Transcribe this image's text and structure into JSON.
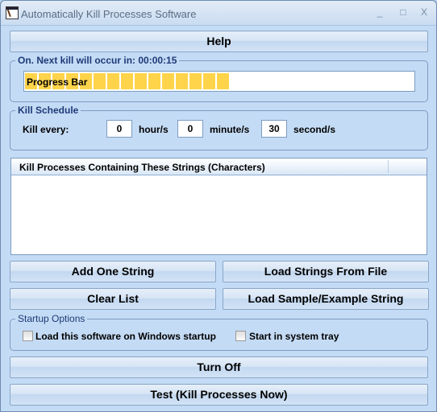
{
  "window": {
    "title": "Automatically Kill Processes Software",
    "controls": {
      "minimize": "_",
      "maximize": "□",
      "close": "X"
    }
  },
  "buttons": {
    "help": "Help",
    "add_one_string": "Add One String",
    "load_strings_from_file": "Load Strings From File",
    "clear_list": "Clear List",
    "load_sample": "Load Sample/Example String",
    "turn_off": "Turn Off",
    "test": "Test (Kill Processes Now)"
  },
  "status_group": {
    "label": "On. Next kill will occur in: 00:00:15",
    "progress_text": "Progress Bar",
    "progress_fraction": 0.55,
    "progress_color": "#ffd44a"
  },
  "schedule": {
    "label": "Kill Schedule",
    "kill_every_label": "Kill every:",
    "hours_value": "0",
    "hours_label": "hour/s",
    "minutes_value": "0",
    "minutes_label": "minute/s",
    "seconds_value": "30",
    "seconds_label": "second/s"
  },
  "list": {
    "column_header": "Kill Processes Containing These Strings (Characters)",
    "items": []
  },
  "startup": {
    "label": "Startup Options",
    "load_on_startup": {
      "label": "Load this software on Windows startup",
      "checked": false
    },
    "start_in_tray": {
      "label": "Start in system tray",
      "checked": false
    }
  }
}
